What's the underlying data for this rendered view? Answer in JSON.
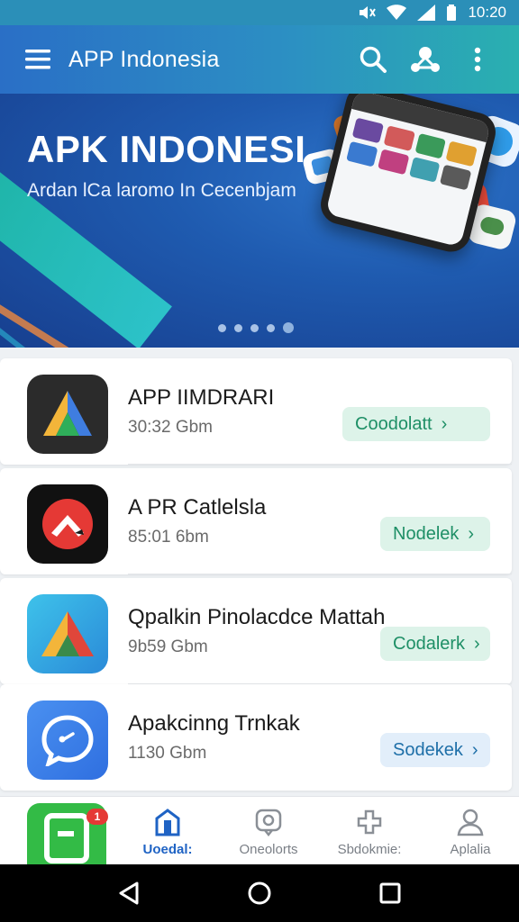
{
  "status_bar": {
    "time": "10:20"
  },
  "app_bar": {
    "title": "APP Indonesia",
    "icons": [
      "menu-icon",
      "search-icon",
      "share-icon",
      "more-vert-icon"
    ]
  },
  "hero": {
    "title": "APK INDONESI",
    "subtitle": "Ardan lCa laromo In Cecenbjam",
    "carousel_pages": 5,
    "carousel_active": 5
  },
  "apps": [
    {
      "name": "APP IIMDRARI",
      "size": "30:32 Gbm",
      "button": "Coodolatt",
      "icon": "a-logo-icon"
    },
    {
      "name": "A PR Catlelsla",
      "size": "85:01 6bm",
      "button": "Nodelek",
      "icon": "chevron-logo-icon"
    },
    {
      "name": "Qpalkin Pinolacdce Mattah",
      "size": "9b59 Gbm",
      "button": "Codalerk",
      "icon": "triangle-logo-icon"
    },
    {
      "name": "Apakcinng Trnkak",
      "size": "1130 Gbm",
      "button": "Sodekek",
      "icon": "chat-bubble-icon"
    }
  ],
  "bottom_nav": {
    "badge": "1",
    "items": [
      {
        "label": "Uoedal:",
        "icon": "home-icon"
      },
      {
        "label": "Oneolorts",
        "icon": "chat-icon"
      },
      {
        "label": "Sbdokmie:",
        "icon": "gamepad-icon"
      },
      {
        "label": "Aplalia",
        "icon": "profile-icon"
      }
    ]
  },
  "colors": {
    "accent": "#1f63c4",
    "download_bg": "#ddf3e9",
    "download_text": "#1e8f66",
    "app_bar_start": "#2a6fc6",
    "app_bar_end": "#2ab0b0"
  }
}
